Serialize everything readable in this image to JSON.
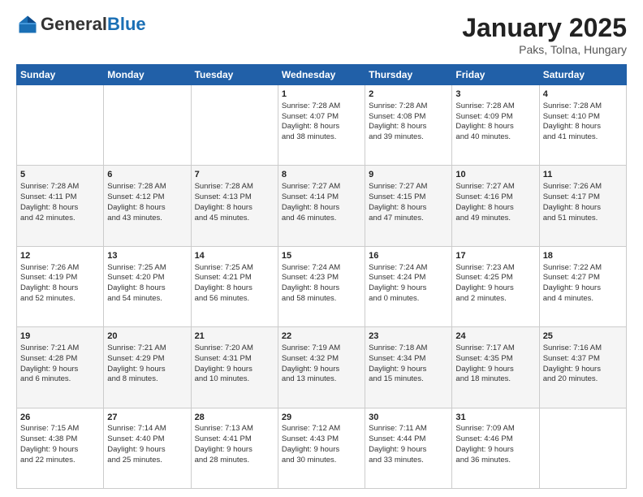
{
  "header": {
    "logo_general": "General",
    "logo_blue": "Blue",
    "title": "January 2025",
    "location": "Paks, Tolna, Hungary"
  },
  "weekdays": [
    "Sunday",
    "Monday",
    "Tuesday",
    "Wednesday",
    "Thursday",
    "Friday",
    "Saturday"
  ],
  "weeks": [
    [
      {
        "day": "",
        "info": ""
      },
      {
        "day": "",
        "info": ""
      },
      {
        "day": "",
        "info": ""
      },
      {
        "day": "1",
        "info": "Sunrise: 7:28 AM\nSunset: 4:07 PM\nDaylight: 8 hours\nand 38 minutes."
      },
      {
        "day": "2",
        "info": "Sunrise: 7:28 AM\nSunset: 4:08 PM\nDaylight: 8 hours\nand 39 minutes."
      },
      {
        "day": "3",
        "info": "Sunrise: 7:28 AM\nSunset: 4:09 PM\nDaylight: 8 hours\nand 40 minutes."
      },
      {
        "day": "4",
        "info": "Sunrise: 7:28 AM\nSunset: 4:10 PM\nDaylight: 8 hours\nand 41 minutes."
      }
    ],
    [
      {
        "day": "5",
        "info": "Sunrise: 7:28 AM\nSunset: 4:11 PM\nDaylight: 8 hours\nand 42 minutes."
      },
      {
        "day": "6",
        "info": "Sunrise: 7:28 AM\nSunset: 4:12 PM\nDaylight: 8 hours\nand 43 minutes."
      },
      {
        "day": "7",
        "info": "Sunrise: 7:28 AM\nSunset: 4:13 PM\nDaylight: 8 hours\nand 45 minutes."
      },
      {
        "day": "8",
        "info": "Sunrise: 7:27 AM\nSunset: 4:14 PM\nDaylight: 8 hours\nand 46 minutes."
      },
      {
        "day": "9",
        "info": "Sunrise: 7:27 AM\nSunset: 4:15 PM\nDaylight: 8 hours\nand 47 minutes."
      },
      {
        "day": "10",
        "info": "Sunrise: 7:27 AM\nSunset: 4:16 PM\nDaylight: 8 hours\nand 49 minutes."
      },
      {
        "day": "11",
        "info": "Sunrise: 7:26 AM\nSunset: 4:17 PM\nDaylight: 8 hours\nand 51 minutes."
      }
    ],
    [
      {
        "day": "12",
        "info": "Sunrise: 7:26 AM\nSunset: 4:19 PM\nDaylight: 8 hours\nand 52 minutes."
      },
      {
        "day": "13",
        "info": "Sunrise: 7:25 AM\nSunset: 4:20 PM\nDaylight: 8 hours\nand 54 minutes."
      },
      {
        "day": "14",
        "info": "Sunrise: 7:25 AM\nSunset: 4:21 PM\nDaylight: 8 hours\nand 56 minutes."
      },
      {
        "day": "15",
        "info": "Sunrise: 7:24 AM\nSunset: 4:23 PM\nDaylight: 8 hours\nand 58 minutes."
      },
      {
        "day": "16",
        "info": "Sunrise: 7:24 AM\nSunset: 4:24 PM\nDaylight: 9 hours\nand 0 minutes."
      },
      {
        "day": "17",
        "info": "Sunrise: 7:23 AM\nSunset: 4:25 PM\nDaylight: 9 hours\nand 2 minutes."
      },
      {
        "day": "18",
        "info": "Sunrise: 7:22 AM\nSunset: 4:27 PM\nDaylight: 9 hours\nand 4 minutes."
      }
    ],
    [
      {
        "day": "19",
        "info": "Sunrise: 7:21 AM\nSunset: 4:28 PM\nDaylight: 9 hours\nand 6 minutes."
      },
      {
        "day": "20",
        "info": "Sunrise: 7:21 AM\nSunset: 4:29 PM\nDaylight: 9 hours\nand 8 minutes."
      },
      {
        "day": "21",
        "info": "Sunrise: 7:20 AM\nSunset: 4:31 PM\nDaylight: 9 hours\nand 10 minutes."
      },
      {
        "day": "22",
        "info": "Sunrise: 7:19 AM\nSunset: 4:32 PM\nDaylight: 9 hours\nand 13 minutes."
      },
      {
        "day": "23",
        "info": "Sunrise: 7:18 AM\nSunset: 4:34 PM\nDaylight: 9 hours\nand 15 minutes."
      },
      {
        "day": "24",
        "info": "Sunrise: 7:17 AM\nSunset: 4:35 PM\nDaylight: 9 hours\nand 18 minutes."
      },
      {
        "day": "25",
        "info": "Sunrise: 7:16 AM\nSunset: 4:37 PM\nDaylight: 9 hours\nand 20 minutes."
      }
    ],
    [
      {
        "day": "26",
        "info": "Sunrise: 7:15 AM\nSunset: 4:38 PM\nDaylight: 9 hours\nand 22 minutes."
      },
      {
        "day": "27",
        "info": "Sunrise: 7:14 AM\nSunset: 4:40 PM\nDaylight: 9 hours\nand 25 minutes."
      },
      {
        "day": "28",
        "info": "Sunrise: 7:13 AM\nSunset: 4:41 PM\nDaylight: 9 hours\nand 28 minutes."
      },
      {
        "day": "29",
        "info": "Sunrise: 7:12 AM\nSunset: 4:43 PM\nDaylight: 9 hours\nand 30 minutes."
      },
      {
        "day": "30",
        "info": "Sunrise: 7:11 AM\nSunset: 4:44 PM\nDaylight: 9 hours\nand 33 minutes."
      },
      {
        "day": "31",
        "info": "Sunrise: 7:09 AM\nSunset: 4:46 PM\nDaylight: 9 hours\nand 36 minutes."
      },
      {
        "day": "",
        "info": ""
      }
    ]
  ]
}
